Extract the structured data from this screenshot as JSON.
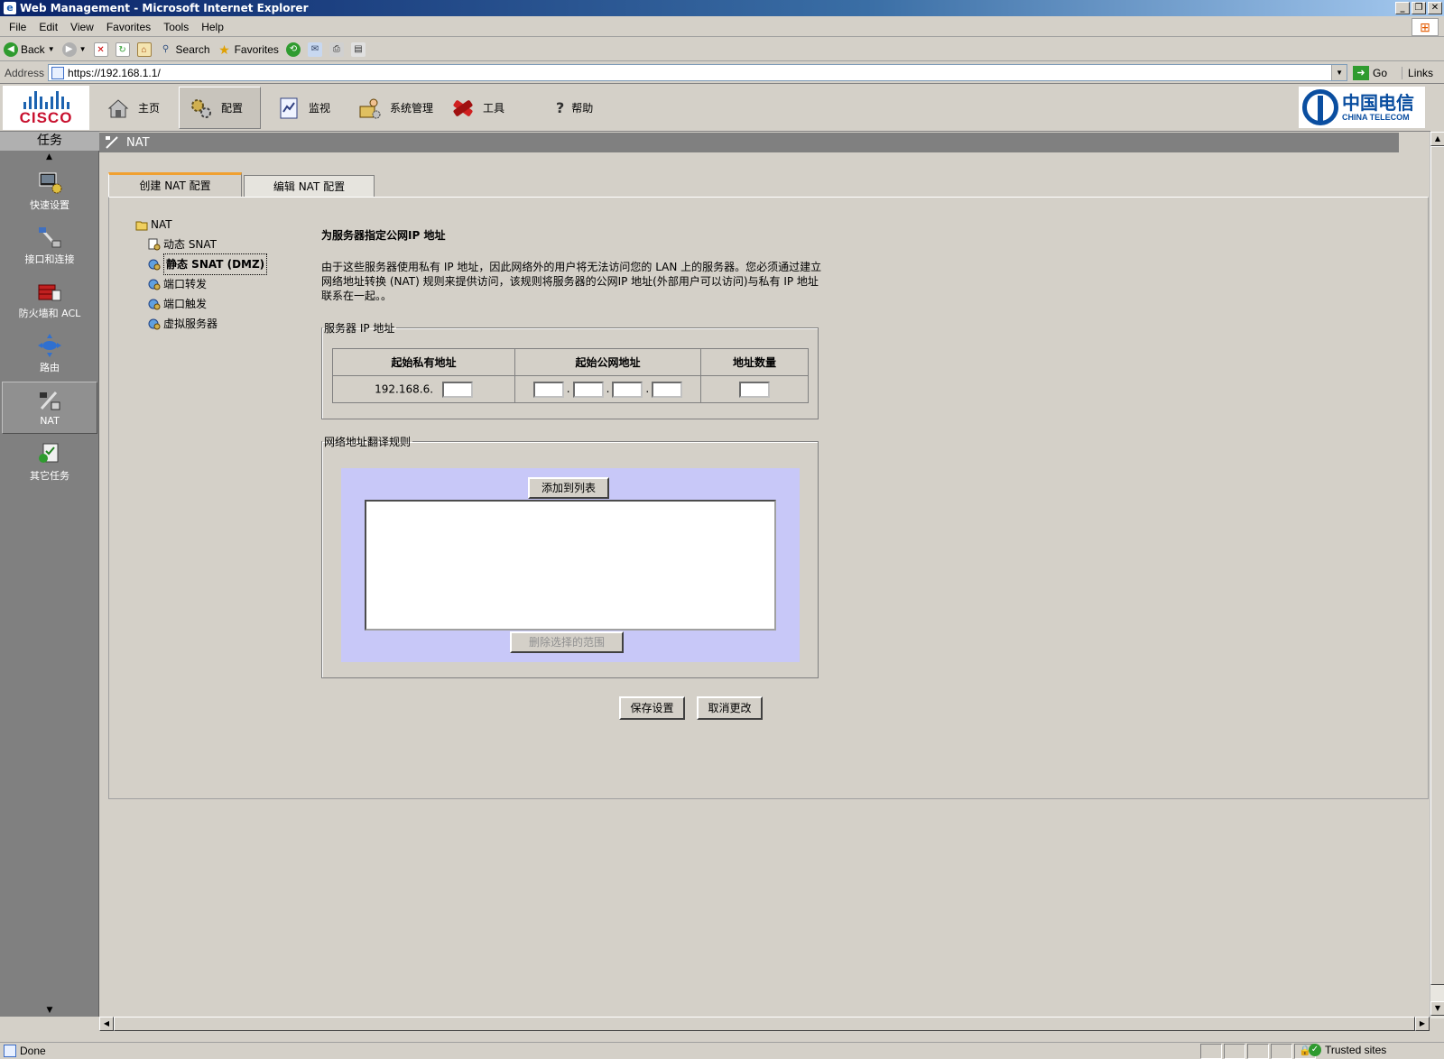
{
  "window": {
    "title": "Web Management - Microsoft Internet Explorer"
  },
  "menu": [
    "File",
    "Edit",
    "View",
    "Favorites",
    "Tools",
    "Help"
  ],
  "toolbar": {
    "back": "Back",
    "search": "Search",
    "favorites": "Favorites"
  },
  "address": {
    "label": "Address",
    "url": "https://192.168.1.1/",
    "go": "Go",
    "links": "Links"
  },
  "header": {
    "cisco_logo": "CISCO",
    "nav": [
      {
        "label": "主页",
        "icon": "home-icon"
      },
      {
        "label": "配置",
        "icon": "gears-icon"
      },
      {
        "label": "监视",
        "icon": "monitor-icon"
      },
      {
        "label": "系统管理",
        "icon": "admin-icon"
      },
      {
        "label": "工具",
        "icon": "tools-icon"
      },
      {
        "label": "帮助",
        "icon": "help-icon"
      }
    ],
    "telecom_cn": "中国电信",
    "telecom_en": "CHINA TELECOM"
  },
  "tasks": {
    "title": "任务",
    "items": [
      {
        "label": "快速设置",
        "icon": "quick-setup-icon"
      },
      {
        "label": "接口和连接",
        "icon": "interfaces-icon"
      },
      {
        "label": "防火墙和 ACL",
        "icon": "firewall-icon"
      },
      {
        "label": "路由",
        "icon": "routing-icon"
      },
      {
        "label": "NAT",
        "icon": "nat-icon"
      },
      {
        "label": "其它任务",
        "icon": "other-tasks-icon"
      }
    ]
  },
  "page": {
    "title": "NAT",
    "tabs": [
      "创建 NAT 配置",
      "编辑 NAT 配置"
    ],
    "tree": {
      "root": "NAT",
      "items": [
        "动态 SNAT",
        "静态 SNAT (DMZ)",
        "端口转发",
        "端口触发",
        "虚拟服务器"
      ]
    },
    "heading": "为服务器指定公网IP 地址",
    "description": "由于这些服务器使用私有 IP 地址，因此网络外的用户将无法访问您的 LAN 上的服务器。您必须通过建立网络地址转换 (NAT) 规则来提供访问，该规则将服务器的公网IP 地址(外部用户可以访问)与私有 IP 地址联系在一起。。",
    "server_ip": {
      "legend": "服务器 IP 地址",
      "col_private": "起始私有地址",
      "col_public": "起始公网地址",
      "col_count": "地址数量",
      "private_prefix": "192.168.6."
    },
    "rules": {
      "legend": "网络地址翻译规则",
      "add": "添加到列表",
      "delete": "删除选择的范围"
    },
    "save": "保存设置",
    "cancel": "取消更改"
  },
  "status": {
    "text": "Done",
    "zone": "Trusted sites"
  }
}
